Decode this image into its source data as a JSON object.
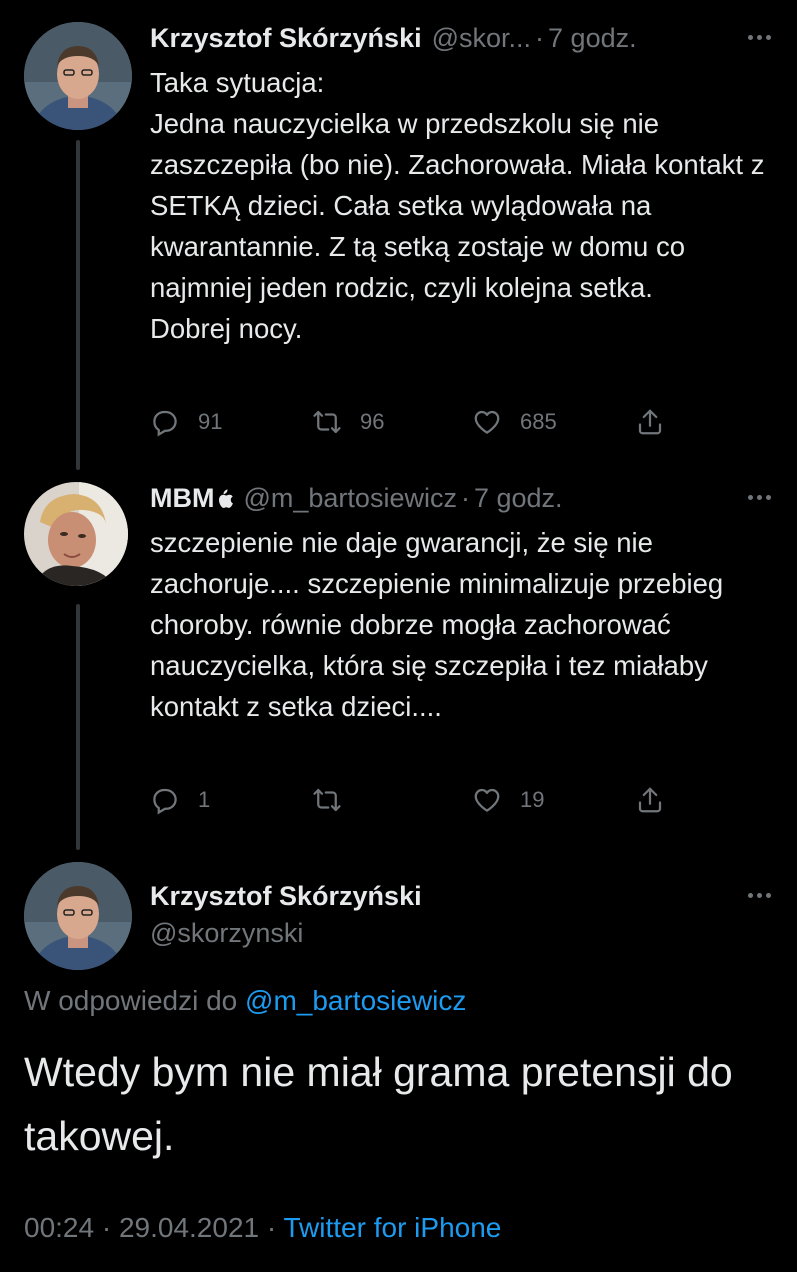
{
  "tweets": [
    {
      "name": "Krzysztof Skórzyński",
      "handle": "@skor...",
      "time": "7 godz.",
      "text": "Taka sytuacja:\nJedna nauczycielka w przedszkolu się nie zaszczepiła (bo nie). Zachorowała. Miała kontakt z SETKĄ dzieci. Cała setka wylądowała na kwarantannie. Z tą setką zostaje w domu co najmniej jeden rodzic, czyli kolejna setka.\nDobrej nocy.",
      "replies": "91",
      "retweets": "96",
      "likes": "685"
    },
    {
      "name": "MBM",
      "name_icon": "apple-logo-icon",
      "handle": "@m_bartosiewicz",
      "time": "7 godz.",
      "text": "szczepienie nie daje gwarancji, że się nie zachoruje.... szczepienie minimalizuje przebieg choroby. równie dobrze mogła zachorować nauczycielka, która się szczepiła i tez miałaby kontakt z setka dzieci....",
      "replies": "1",
      "retweets": "",
      "likes": "19"
    }
  ],
  "main_tweet": {
    "name": "Krzysztof Skórzyński",
    "handle": "@skorzynski",
    "reply_prefix": "W odpowiedzi do",
    "reply_to": "@m_bartosiewicz",
    "text": "Wtedy bym nie miał grama pretensji do takowej.",
    "timestamp": "00:24 · 29.04.2021",
    "separator": "·",
    "source": "Twitter for iPhone"
  },
  "separator_dot": "·",
  "colors": {
    "background": "#000000",
    "text_primary": "#e7e9ea",
    "text_secondary": "#71767b",
    "link": "#1d9bf0",
    "thread_line": "#333639"
  }
}
